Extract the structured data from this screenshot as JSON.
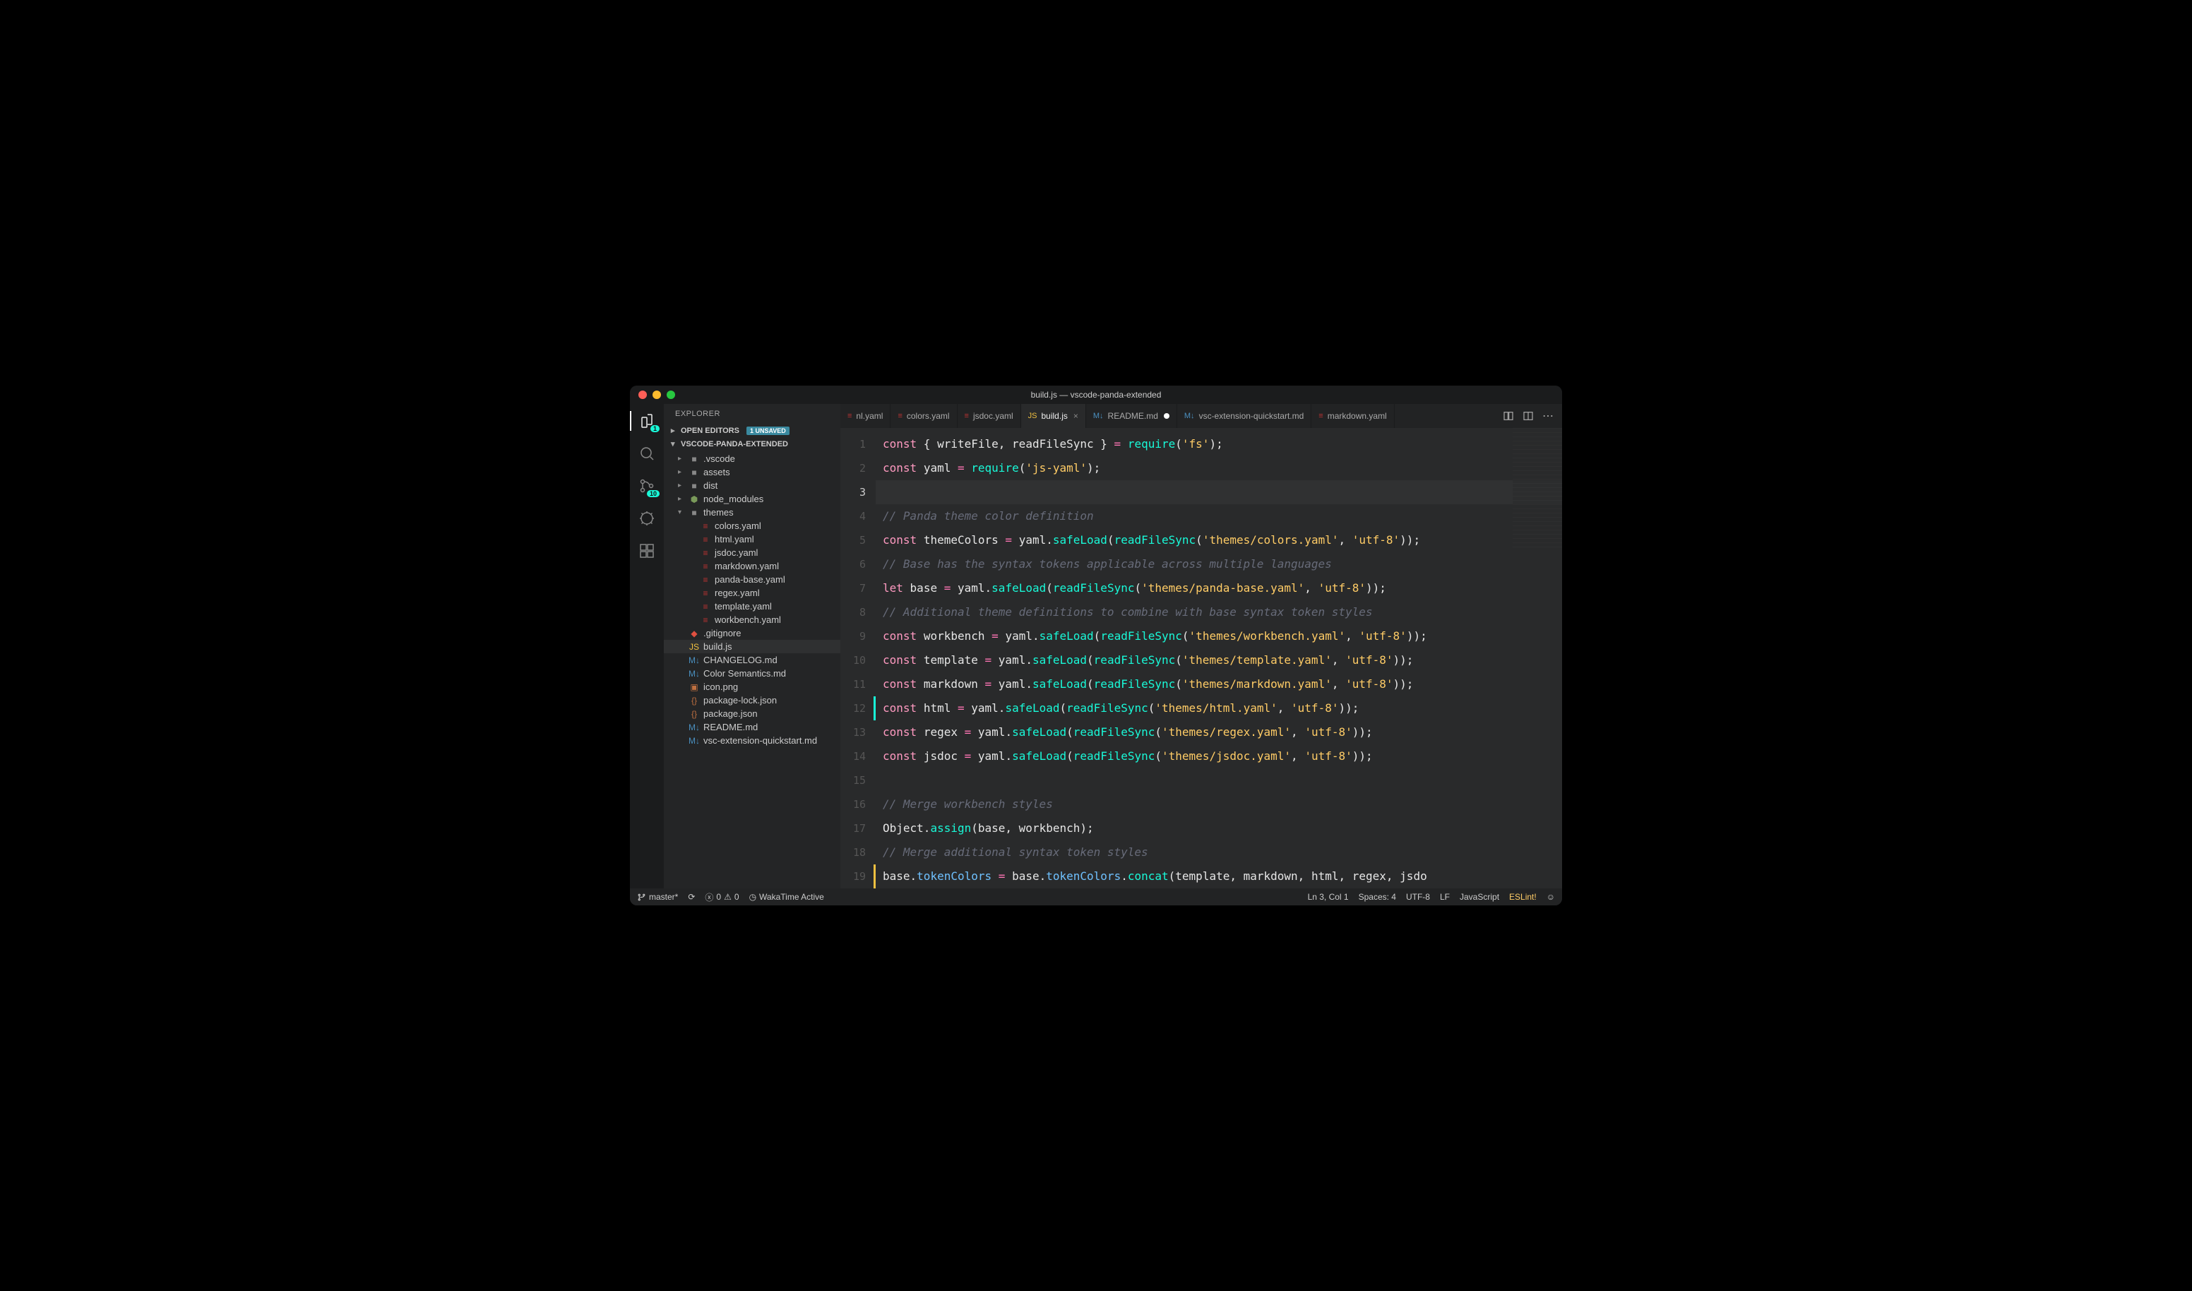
{
  "title": "build.js — vscode-panda-extended",
  "sidebar": {
    "header": "EXPLORER",
    "openEditors": {
      "label": "OPEN EDITORS",
      "badge": "1 UNSAVED"
    },
    "project": "VSCODE-PANDA-EXTENDED",
    "tree": [
      {
        "depth": 1,
        "type": "folder",
        "label": ".vscode",
        "expanded": false,
        "chev": true
      },
      {
        "depth": 1,
        "type": "folder",
        "label": "assets",
        "expanded": false,
        "chev": true
      },
      {
        "depth": 1,
        "type": "folder",
        "label": "dist",
        "expanded": false,
        "chev": true
      },
      {
        "depth": 1,
        "type": "node",
        "label": "node_modules",
        "expanded": false,
        "chev": true
      },
      {
        "depth": 1,
        "type": "folder",
        "label": "themes",
        "expanded": true,
        "chev": true
      },
      {
        "depth": 2,
        "type": "yaml",
        "label": "colors.yaml"
      },
      {
        "depth": 2,
        "type": "yaml",
        "label": "html.yaml"
      },
      {
        "depth": 2,
        "type": "yaml",
        "label": "jsdoc.yaml"
      },
      {
        "depth": 2,
        "type": "yaml",
        "label": "markdown.yaml"
      },
      {
        "depth": 2,
        "type": "yaml",
        "label": "panda-base.yaml"
      },
      {
        "depth": 2,
        "type": "yaml",
        "label": "regex.yaml"
      },
      {
        "depth": 2,
        "type": "yaml",
        "label": "template.yaml"
      },
      {
        "depth": 2,
        "type": "yaml",
        "label": "workbench.yaml"
      },
      {
        "depth": 1,
        "type": "git",
        "label": ".gitignore"
      },
      {
        "depth": 1,
        "type": "js",
        "label": "build.js",
        "selected": true
      },
      {
        "depth": 1,
        "type": "md",
        "label": "CHANGELOG.md"
      },
      {
        "depth": 1,
        "type": "md",
        "label": "Color Semantics.md"
      },
      {
        "depth": 1,
        "type": "png",
        "label": "icon.png"
      },
      {
        "depth": 1,
        "type": "json",
        "label": "package-lock.json"
      },
      {
        "depth": 1,
        "type": "json",
        "label": "package.json"
      },
      {
        "depth": 1,
        "type": "md",
        "label": "README.md"
      },
      {
        "depth": 1,
        "type": "md",
        "label": "vsc-extension-quickstart.md"
      }
    ]
  },
  "activity": {
    "explorerBadge": "1",
    "scmBadge": "10"
  },
  "tabs": [
    {
      "icon": "yaml",
      "label": "nl.yaml"
    },
    {
      "icon": "yaml",
      "label": "colors.yaml"
    },
    {
      "icon": "yaml",
      "label": "jsdoc.yaml"
    },
    {
      "icon": "js",
      "label": "build.js",
      "active": true,
      "close": true
    },
    {
      "icon": "md",
      "label": "README.md",
      "modified": true
    },
    {
      "icon": "md",
      "label": "vsc-extension-quickstart.md"
    },
    {
      "icon": "yaml",
      "label": "markdown.yaml"
    }
  ],
  "code": {
    "lines": [
      {
        "n": 1,
        "tokens": [
          [
            "kw",
            "const"
          ],
          [
            "pn",
            " { "
          ],
          [
            "id",
            "writeFile"
          ],
          [
            "pn",
            ", "
          ],
          [
            "id",
            "readFileSync"
          ],
          [
            "pn",
            " } "
          ],
          [
            "op",
            "="
          ],
          [
            "pn",
            " "
          ],
          [
            "fn",
            "require"
          ],
          [
            "pn",
            "("
          ],
          [
            "str",
            "'fs'"
          ],
          [
            "pn",
            ");"
          ]
        ]
      },
      {
        "n": 2,
        "tokens": [
          [
            "kw",
            "const"
          ],
          [
            "pn",
            " "
          ],
          [
            "id",
            "yaml"
          ],
          [
            "pn",
            " "
          ],
          [
            "op",
            "="
          ],
          [
            "pn",
            " "
          ],
          [
            "fn",
            "require"
          ],
          [
            "pn",
            "("
          ],
          [
            "str",
            "'js-yaml'"
          ],
          [
            "pn",
            ");"
          ]
        ]
      },
      {
        "n": 3,
        "current": true,
        "tokens": []
      },
      {
        "n": 4,
        "tokens": [
          [
            "cm",
            "// Panda theme color definition"
          ]
        ]
      },
      {
        "n": 5,
        "tokens": [
          [
            "kw",
            "const"
          ],
          [
            "pn",
            " "
          ],
          [
            "id",
            "themeColors"
          ],
          [
            "pn",
            " "
          ],
          [
            "op",
            "="
          ],
          [
            "pn",
            " "
          ],
          [
            "id",
            "yaml"
          ],
          [
            "pn",
            "."
          ],
          [
            "fn",
            "safeLoad"
          ],
          [
            "pn",
            "("
          ],
          [
            "fn",
            "readFileSync"
          ],
          [
            "pn",
            "("
          ],
          [
            "str",
            "'themes/colors.yaml'"
          ],
          [
            "pn",
            ", "
          ],
          [
            "str",
            "'utf-8'"
          ],
          [
            "pn",
            "));"
          ]
        ]
      },
      {
        "n": 6,
        "tokens": [
          [
            "cm",
            "// Base has the syntax tokens applicable across multiple languages"
          ]
        ]
      },
      {
        "n": 7,
        "tokens": [
          [
            "kw",
            "let"
          ],
          [
            "pn",
            " "
          ],
          [
            "id",
            "base"
          ],
          [
            "pn",
            " "
          ],
          [
            "op",
            "="
          ],
          [
            "pn",
            " "
          ],
          [
            "id",
            "yaml"
          ],
          [
            "pn",
            "."
          ],
          [
            "fn",
            "safeLoad"
          ],
          [
            "pn",
            "("
          ],
          [
            "fn",
            "readFileSync"
          ],
          [
            "pn",
            "("
          ],
          [
            "str",
            "'themes/panda-base.yaml'"
          ],
          [
            "pn",
            ", "
          ],
          [
            "str",
            "'utf-8'"
          ],
          [
            "pn",
            "));"
          ]
        ]
      },
      {
        "n": 8,
        "tokens": [
          [
            "cm",
            "// Additional theme definitions to combine with base syntax token styles"
          ]
        ]
      },
      {
        "n": 9,
        "tokens": [
          [
            "kw",
            "const"
          ],
          [
            "pn",
            " "
          ],
          [
            "id",
            "workbench"
          ],
          [
            "pn",
            " "
          ],
          [
            "op",
            "="
          ],
          [
            "pn",
            " "
          ],
          [
            "id",
            "yaml"
          ],
          [
            "pn",
            "."
          ],
          [
            "fn",
            "safeLoad"
          ],
          [
            "pn",
            "("
          ],
          [
            "fn",
            "readFileSync"
          ],
          [
            "pn",
            "("
          ],
          [
            "str",
            "'themes/workbench.yaml'"
          ],
          [
            "pn",
            ", "
          ],
          [
            "str",
            "'utf-8'"
          ],
          [
            "pn",
            "));"
          ]
        ]
      },
      {
        "n": 10,
        "tokens": [
          [
            "kw",
            "const"
          ],
          [
            "pn",
            " "
          ],
          [
            "id",
            "template"
          ],
          [
            "pn",
            " "
          ],
          [
            "op",
            "="
          ],
          [
            "pn",
            " "
          ],
          [
            "id",
            "yaml"
          ],
          [
            "pn",
            "."
          ],
          [
            "fn",
            "safeLoad"
          ],
          [
            "pn",
            "("
          ],
          [
            "fn",
            "readFileSync"
          ],
          [
            "pn",
            "("
          ],
          [
            "str",
            "'themes/template.yaml'"
          ],
          [
            "pn",
            ", "
          ],
          [
            "str",
            "'utf-8'"
          ],
          [
            "pn",
            "));"
          ]
        ]
      },
      {
        "n": 11,
        "tokens": [
          [
            "kw",
            "const"
          ],
          [
            "pn",
            " "
          ],
          [
            "id",
            "markdown"
          ],
          [
            "pn",
            " "
          ],
          [
            "op",
            "="
          ],
          [
            "pn",
            " "
          ],
          [
            "id",
            "yaml"
          ],
          [
            "pn",
            "."
          ],
          [
            "fn",
            "safeLoad"
          ],
          [
            "pn",
            "("
          ],
          [
            "fn",
            "readFileSync"
          ],
          [
            "pn",
            "("
          ],
          [
            "str",
            "'themes/markdown.yaml'"
          ],
          [
            "pn",
            ", "
          ],
          [
            "str",
            "'utf-8'"
          ],
          [
            "pn",
            "));"
          ]
        ]
      },
      {
        "n": 12,
        "diff": true,
        "tokens": [
          [
            "kw",
            "const"
          ],
          [
            "pn",
            " "
          ],
          [
            "id",
            "html"
          ],
          [
            "pn",
            " "
          ],
          [
            "op",
            "="
          ],
          [
            "pn",
            " "
          ],
          [
            "id",
            "yaml"
          ],
          [
            "pn",
            "."
          ],
          [
            "fn",
            "safeLoad"
          ],
          [
            "pn",
            "("
          ],
          [
            "fn",
            "readFileSync"
          ],
          [
            "pn",
            "("
          ],
          [
            "str",
            "'themes/html.yaml'"
          ],
          [
            "pn",
            ", "
          ],
          [
            "str",
            "'utf-8'"
          ],
          [
            "pn",
            "));"
          ]
        ]
      },
      {
        "n": 13,
        "tokens": [
          [
            "kw",
            "const"
          ],
          [
            "pn",
            " "
          ],
          [
            "id",
            "regex"
          ],
          [
            "pn",
            " "
          ],
          [
            "op",
            "="
          ],
          [
            "pn",
            " "
          ],
          [
            "id",
            "yaml"
          ],
          [
            "pn",
            "."
          ],
          [
            "fn",
            "safeLoad"
          ],
          [
            "pn",
            "("
          ],
          [
            "fn",
            "readFileSync"
          ],
          [
            "pn",
            "("
          ],
          [
            "str",
            "'themes/regex.yaml'"
          ],
          [
            "pn",
            ", "
          ],
          [
            "str",
            "'utf-8'"
          ],
          [
            "pn",
            "));"
          ]
        ]
      },
      {
        "n": 14,
        "tokens": [
          [
            "kw",
            "const"
          ],
          [
            "pn",
            " "
          ],
          [
            "id",
            "jsdoc"
          ],
          [
            "pn",
            " "
          ],
          [
            "op",
            "="
          ],
          [
            "pn",
            " "
          ],
          [
            "id",
            "yaml"
          ],
          [
            "pn",
            "."
          ],
          [
            "fn",
            "safeLoad"
          ],
          [
            "pn",
            "("
          ],
          [
            "fn",
            "readFileSync"
          ],
          [
            "pn",
            "("
          ],
          [
            "str",
            "'themes/jsdoc.yaml'"
          ],
          [
            "pn",
            ", "
          ],
          [
            "str",
            "'utf-8'"
          ],
          [
            "pn",
            "));"
          ]
        ]
      },
      {
        "n": 15,
        "tokens": []
      },
      {
        "n": 16,
        "tokens": [
          [
            "cm",
            "// Merge workbench styles"
          ]
        ]
      },
      {
        "n": 17,
        "tokens": [
          [
            "id",
            "Object"
          ],
          [
            "pn",
            "."
          ],
          [
            "fn",
            "assign"
          ],
          [
            "pn",
            "("
          ],
          [
            "id",
            "base"
          ],
          [
            "pn",
            ", "
          ],
          [
            "id",
            "workbench"
          ],
          [
            "pn",
            ");"
          ]
        ]
      },
      {
        "n": 18,
        "tokens": [
          [
            "cm",
            "// Merge additional syntax token styles"
          ]
        ]
      },
      {
        "n": 19,
        "diffmod": true,
        "tokens": [
          [
            "id",
            "base"
          ],
          [
            "pn",
            "."
          ],
          [
            "prop",
            "tokenColors"
          ],
          [
            "pn",
            " "
          ],
          [
            "op",
            "="
          ],
          [
            "pn",
            " "
          ],
          [
            "id",
            "base"
          ],
          [
            "pn",
            "."
          ],
          [
            "prop",
            "tokenColors"
          ],
          [
            "pn",
            "."
          ],
          [
            "fn",
            "concat"
          ],
          [
            "pn",
            "("
          ],
          [
            "id",
            "template"
          ],
          [
            "pn",
            ", "
          ],
          [
            "id",
            "markdown"
          ],
          [
            "pn",
            ", "
          ],
          [
            "id",
            "html"
          ],
          [
            "pn",
            ", "
          ],
          [
            "id",
            "regex"
          ],
          [
            "pn",
            ", "
          ],
          [
            "id",
            "jsdo"
          ]
        ]
      }
    ]
  },
  "statusbar": {
    "branch": "master*",
    "sync": "⟳",
    "errors": "0",
    "warnings": "0",
    "wakatime": "WakaTime Active",
    "position": "Ln 3, Col 1",
    "spaces": "Spaces: 4",
    "encoding": "UTF-8",
    "eol": "LF",
    "language": "JavaScript",
    "eslint": "ESLint!",
    "smiley": "☺"
  }
}
